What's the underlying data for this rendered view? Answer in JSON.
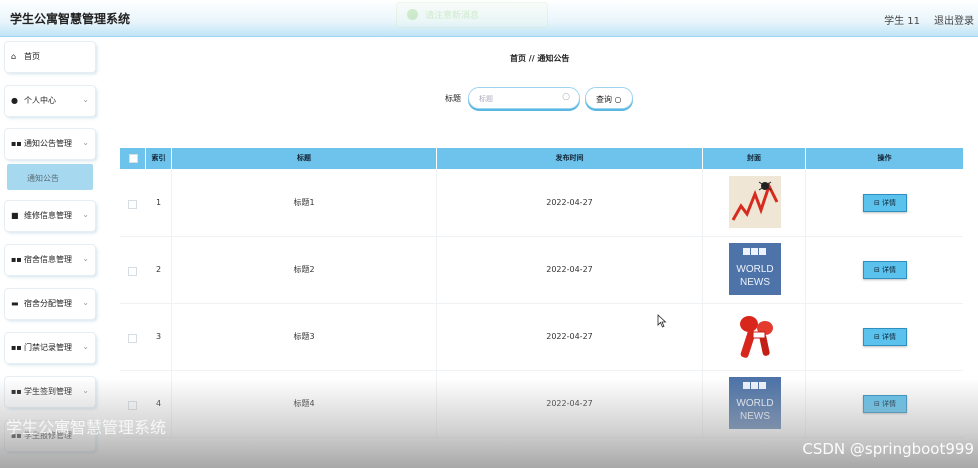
{
  "header": {
    "app_title": "学生公寓智慧管理系统",
    "toast_text": "请注意新消息",
    "user_label": "学生 11",
    "logout_label": "退出登录"
  },
  "sidebar": {
    "items": [
      {
        "label": "首页",
        "icon": "home-icon",
        "has_caret": false
      },
      {
        "label": "个人中心",
        "icon": "user-icon",
        "has_caret": true
      },
      {
        "label": "通知公告管理",
        "icon": "grid-icon",
        "has_caret": true
      },
      {
        "label": "维修信息管理",
        "icon": "lock-icon",
        "has_caret": true
      },
      {
        "label": "宿舍信息管理",
        "icon": "grid-icon",
        "has_caret": true
      },
      {
        "label": "宿舍分配管理",
        "icon": "briefcase-icon",
        "has_caret": true
      },
      {
        "label": "门禁记录管理",
        "icon": "grid-icon",
        "has_caret": true
      },
      {
        "label": "学生签到管理",
        "icon": "grid-icon",
        "has_caret": true
      },
      {
        "label": "学生报修管理",
        "icon": "grid-icon",
        "has_caret": true
      }
    ],
    "active_submenu": "通知公告"
  },
  "breadcrumb": "首页 // 通知公告",
  "search": {
    "label": "标题",
    "placeholder": "标题",
    "button_label": "查询 ○"
  },
  "table": {
    "columns": [
      "索引",
      "标题",
      "发布时间",
      "封面",
      "操作"
    ],
    "rows": [
      {
        "index": "1",
        "title": "标题1",
        "date": "2022-04-27",
        "cover": "stock-chart-thumbnail",
        "action": "⊟ 详情"
      },
      {
        "index": "2",
        "title": "标题2",
        "date": "2022-04-27",
        "cover": "bbc-world-news-thumbnail",
        "action": "⊟ 详情"
      },
      {
        "index": "3",
        "title": "标题3",
        "date": "2022-04-27",
        "cover": "microphones-thumbnail",
        "action": "⊟ 详情"
      },
      {
        "index": "4",
        "title": "标题4",
        "date": "2022-04-27",
        "cover": "bbc-world-news-thumbnail",
        "action": "⊟ 详情"
      }
    ]
  },
  "watermarks": {
    "left": "学生公寓智慧管理系统",
    "right": "CSDN @springboot999"
  },
  "colors": {
    "accent": "#6ec3ec",
    "button": "#5bc2ee",
    "submenu_active": "#a6d9f0"
  }
}
